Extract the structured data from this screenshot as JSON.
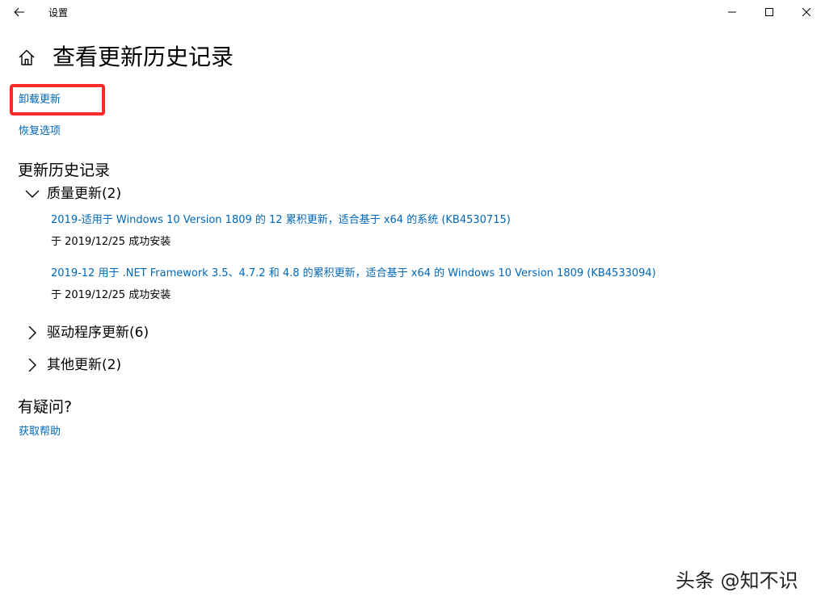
{
  "window": {
    "title": "设置"
  },
  "page": {
    "title": "查看更新历史记录"
  },
  "links": {
    "uninstall_updates": "卸载更新",
    "recovery_options": "恢复选项"
  },
  "history": {
    "heading": "更新历史记录",
    "groups": [
      {
        "label": "质量更新(2)",
        "expanded": true,
        "items": [
          {
            "title": "2019-适用于 Windows 10 Version 1809 的 12 累积更新，适合基于 x64 的系统 (KB4530715)",
            "status": "于 2019/12/25 成功安装"
          },
          {
            "title": "2019-12 用于 .NET Framework 3.5、4.7.2 和 4.8 的累积更新，适合基于 x64 的 Windows 10 Version 1809 (KB4533094)",
            "status": "于 2019/12/25 成功安装"
          }
        ]
      },
      {
        "label": "驱动程序更新(6)",
        "expanded": false
      },
      {
        "label": "其他更新(2)",
        "expanded": false
      }
    ]
  },
  "help": {
    "heading": "有疑问?",
    "link": "获取帮助"
  },
  "watermark": {
    "text": "头条 @知不识"
  },
  "icons": {
    "back": "back-arrow-icon",
    "home": "home-icon",
    "minimize": "minimize-icon",
    "maximize": "maximize-icon",
    "close": "close-icon",
    "expanded": "chevron-down-icon",
    "collapsed": "chevron-right-icon"
  },
  "colors": {
    "link": "#0067b8",
    "highlight": "#ff2a2a",
    "background": "#ffffff",
    "text": "#000000"
  }
}
